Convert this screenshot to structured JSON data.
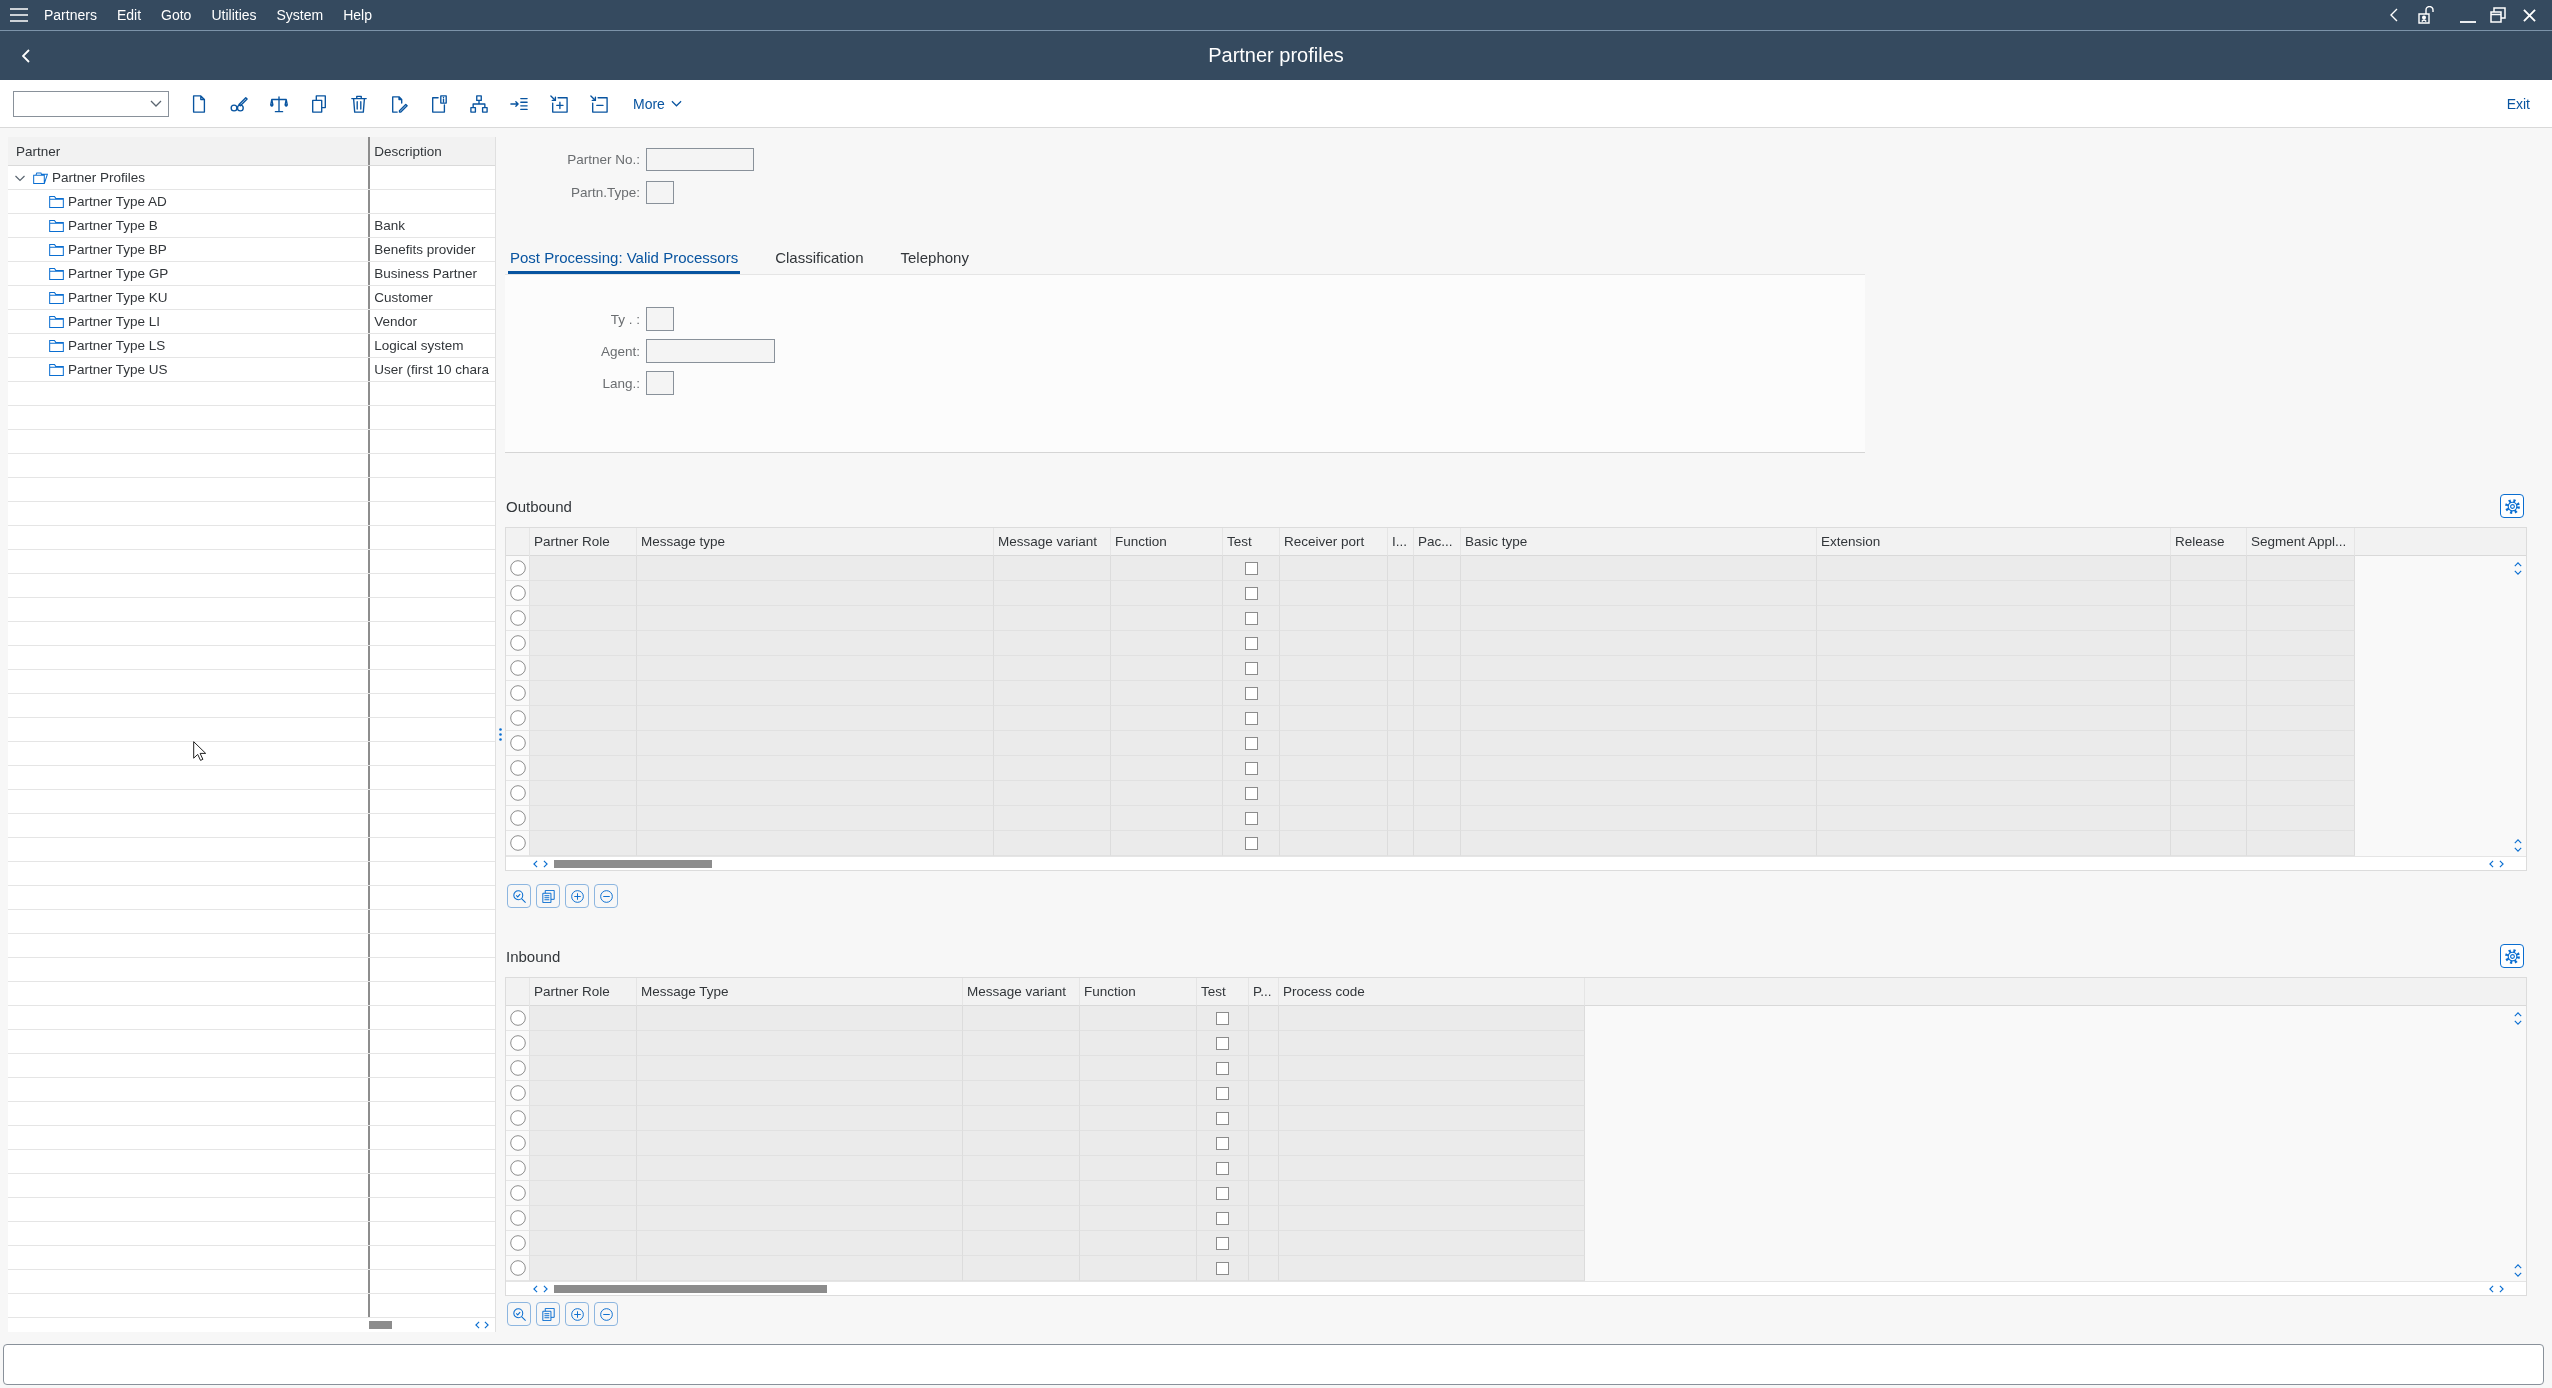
{
  "menu_bar": {
    "items": [
      "Partners",
      "Edit",
      "Goto",
      "Utilities",
      "System",
      "Help"
    ]
  },
  "title_bar": {
    "title": "Partner profiles"
  },
  "toolbar": {
    "more_button": "More",
    "exit_button": "Exit"
  },
  "tree": {
    "columns": [
      "Partner",
      "Description"
    ],
    "root": {
      "label": "Partner Profiles",
      "expanded": true,
      "children": [
        {
          "label": "Partner Type AD"
        },
        {
          "label": "Partner Type B",
          "description": "Bank"
        },
        {
          "label": "Partner Type BP",
          "description": "Benefits provider"
        },
        {
          "label": "Partner Type GP",
          "description": "Business Partner"
        },
        {
          "label": "Partner Type KU",
          "description": "Customer"
        },
        {
          "label": "Partner Type LI",
          "description": "Vendor"
        },
        {
          "label": "Partner Type LS",
          "description": "Logical system"
        },
        {
          "label": "Partner Type US",
          "description": "User (first 10 chara"
        }
      ]
    }
  },
  "header_form": {
    "fields": [
      "Partner No.:",
      "Partn.Type:"
    ]
  },
  "tabs": [
    {
      "label": "Post Processing: Valid Processors",
      "selected": true
    },
    {
      "label": "Classification",
      "selected": false
    },
    {
      "label": "Telephony",
      "selected": false
    }
  ],
  "tab_panel": {
    "fields": [
      "Ty . :",
      "Agent:",
      "Lang.:"
    ]
  },
  "outbound": {
    "title": "Outbound",
    "columns": [
      {
        "label": "Partner Role",
        "kind": "text"
      },
      {
        "label": "Message type",
        "kind": "text"
      },
      {
        "label": "Message variant",
        "kind": "text"
      },
      {
        "label": "Function",
        "kind": "text"
      },
      {
        "label": "Test",
        "kind": "checkbox"
      },
      {
        "label": "Receiver port",
        "kind": "text"
      },
      {
        "label": "I...",
        "kind": "text"
      },
      {
        "label": "Pac...",
        "kind": "text"
      },
      {
        "label": "Basic type",
        "kind": "text"
      },
      {
        "label": "Extension",
        "kind": "text"
      },
      {
        "label": "Release",
        "kind": "text"
      },
      {
        "label": "Segment Appl...",
        "kind": "text"
      }
    ],
    "rows": [
      {
        "selected": false,
        "checked": false
      },
      {
        "selected": false,
        "checked": false
      },
      {
        "selected": false,
        "checked": false
      },
      {
        "selected": false,
        "checked": false
      },
      {
        "selected": false,
        "checked": false
      },
      {
        "selected": false,
        "checked": false
      },
      {
        "selected": false,
        "checked": false
      },
      {
        "selected": false,
        "checked": false
      },
      {
        "selected": false,
        "checked": false
      },
      {
        "selected": false,
        "checked": false
      },
      {
        "selected": false,
        "checked": false
      },
      {
        "selected": false,
        "checked": false
      }
    ]
  },
  "inbound": {
    "title": "Inbound",
    "columns": [
      {
        "label": "Partner Role",
        "kind": "text"
      },
      {
        "label": "Message Type",
        "kind": "text"
      },
      {
        "label": "Message variant",
        "kind": "text"
      },
      {
        "label": "Function",
        "kind": "text"
      },
      {
        "label": "Test",
        "kind": "checkbox"
      },
      {
        "label": "P...",
        "kind": "text"
      },
      {
        "label": "Process code",
        "kind": "text"
      }
    ],
    "rows": [
      {
        "selected": false,
        "checked": false
      },
      {
        "selected": false,
        "checked": false
      },
      {
        "selected": false,
        "checked": false
      },
      {
        "selected": false,
        "checked": false
      },
      {
        "selected": false,
        "checked": false
      },
      {
        "selected": false,
        "checked": false
      },
      {
        "selected": false,
        "checked": false
      },
      {
        "selected": false,
        "checked": false
      },
      {
        "selected": false,
        "checked": false
      },
      {
        "selected": false,
        "checked": false
      },
      {
        "selected": false,
        "checked": false
      }
    ]
  }
}
